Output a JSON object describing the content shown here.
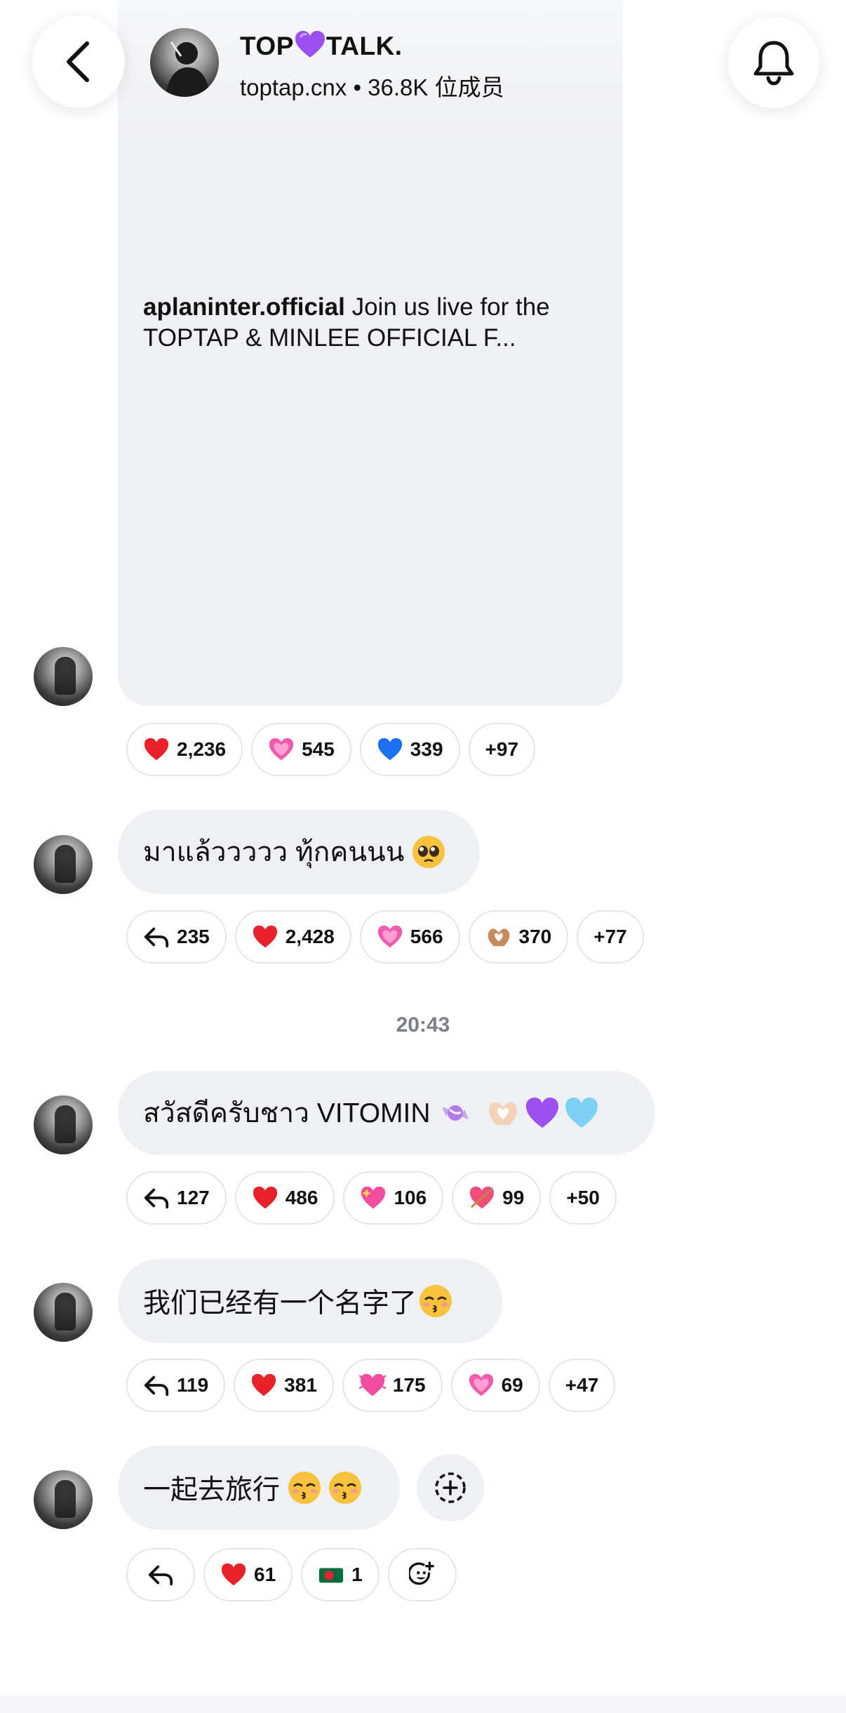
{
  "header": {
    "title_left": "TOP",
    "title_right": "TALK.",
    "handle": "toptap.cnx",
    "members": "• 36.8K 位成员"
  },
  "post": {
    "author": "aplaninter.official",
    "text": "Join us live for the TOPTAP & MINLEE OFFICIAL F...",
    "reactions": [
      {
        "icon": "red-heart-icon",
        "count": "2,236"
      },
      {
        "icon": "pink-heart-icon",
        "count": "545"
      },
      {
        "icon": "blue-heart-icon",
        "count": "339"
      },
      {
        "icon": "",
        "count": "+97"
      }
    ]
  },
  "messages": [
    {
      "text": "มาแล้ววววว ทุ้กคนนน",
      "reactions": [
        {
          "icon": "reply-icon",
          "count": "235"
        },
        {
          "icon": "red-heart-icon",
          "count": "2,428"
        },
        {
          "icon": "pink-heart-icon",
          "count": "566"
        },
        {
          "icon": "heart-hands-icon",
          "count": "370"
        },
        {
          "icon": "",
          "count": "+77"
        }
      ]
    },
    {
      "text": "สวัสดีครับชาว VITOMIN",
      "reactions": [
        {
          "icon": "reply-icon",
          "count": "127"
        },
        {
          "icon": "red-heart-icon",
          "count": "486"
        },
        {
          "icon": "sparkling-heart-icon",
          "count": "106"
        },
        {
          "icon": "heart-arrow-icon",
          "count": "99"
        },
        {
          "icon": "",
          "count": "+50"
        }
      ]
    },
    {
      "text": "我们已经有一个名字了",
      "reactions": [
        {
          "icon": "reply-icon",
          "count": "119"
        },
        {
          "icon": "red-heart-icon",
          "count": "381"
        },
        {
          "icon": "beating-heart-icon",
          "count": "175"
        },
        {
          "icon": "pink-heart-icon",
          "count": "69"
        },
        {
          "icon": "",
          "count": "+47"
        }
      ]
    },
    {
      "text": "一起去旅行",
      "reactions": [
        {
          "icon": "reply-icon",
          "count": ""
        },
        {
          "icon": "red-heart-icon",
          "count": "61"
        },
        {
          "icon": "bangladesh-flag-icon",
          "count": "1"
        },
        {
          "icon": "add-emoji-icon",
          "count": ""
        }
      ]
    }
  ],
  "timestamp": "20:43"
}
